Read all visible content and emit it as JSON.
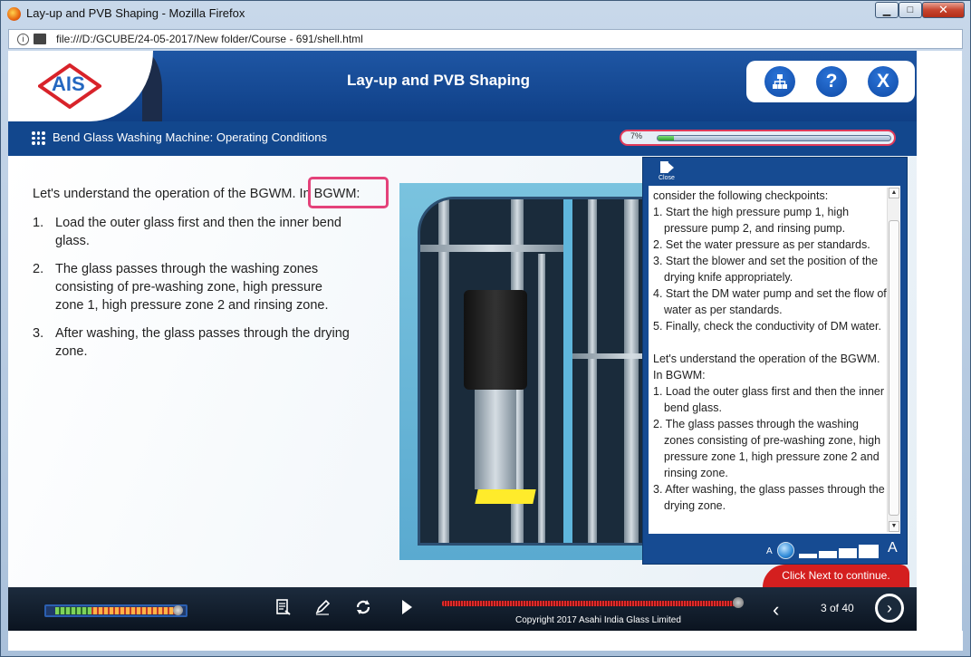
{
  "window": {
    "title": "Lay-up and PVB Shaping - Mozilla Firefox",
    "url": "file:///D:/GCUBE/24-05-2017/New folder/Course - 691/shell.html",
    "min_label": "▁",
    "max_label": "□",
    "close_label": "✕"
  },
  "header": {
    "logo_text": "AIS",
    "course_title": "Lay-up and PVB Shaping",
    "menu_icon": "sitemap-icon",
    "help_label": "?",
    "exit_label": "X"
  },
  "subheader": {
    "title": "Bend Glass Washing Machine: Operating Conditions",
    "progress_label": "7%",
    "progress_value": 7
  },
  "slide": {
    "intro_a": "Let's understand the operation of the BGWM.",
    "intro_b": " In BGWM:",
    "steps": [
      {
        "num": "1.",
        "text": "Load the outer glass first and then the inner bend glass."
      },
      {
        "num": "2.",
        "text": "The glass passes through the washing zones consisting of pre-washing zone, high pressure zone 1, high pressure zone 2 and rinsing zone."
      },
      {
        "num": "3.",
        "text": "After washing, the glass passes through the drying zone."
      }
    ]
  },
  "panel": {
    "close_label": "Close",
    "lines": [
      "consider the following checkpoints:",
      "1. Start the high pressure pump 1, high pressure pump 2, and rinsing pump.",
      "2. Set the water pressure as per standards.",
      "3. Start the blower and set the position of the drying knife appropriately.",
      "4. Start the DM water pump and set the flow of water as per standards.",
      "5. Finally, check the conductivity of DM water.",
      "",
      "Let's understand the operation of the BGWM. In BGWM:",
      "1. Load the outer glass first and then the inner bend glass.",
      "2. The glass passes through the washing zones consisting of pre-washing zone, high pressure zone 1, high pressure zone 2 and rinsing zone.",
      "3. After washing, the glass passes through the drying zone."
    ],
    "font_small": "A",
    "font_large": "A"
  },
  "next_message": "Click Next to continue.",
  "footer": {
    "copyright": "Copyright 2017 Asahi India Glass Limited",
    "page_count": "3 of 40",
    "prev_label": "‹",
    "next_label": "›"
  }
}
